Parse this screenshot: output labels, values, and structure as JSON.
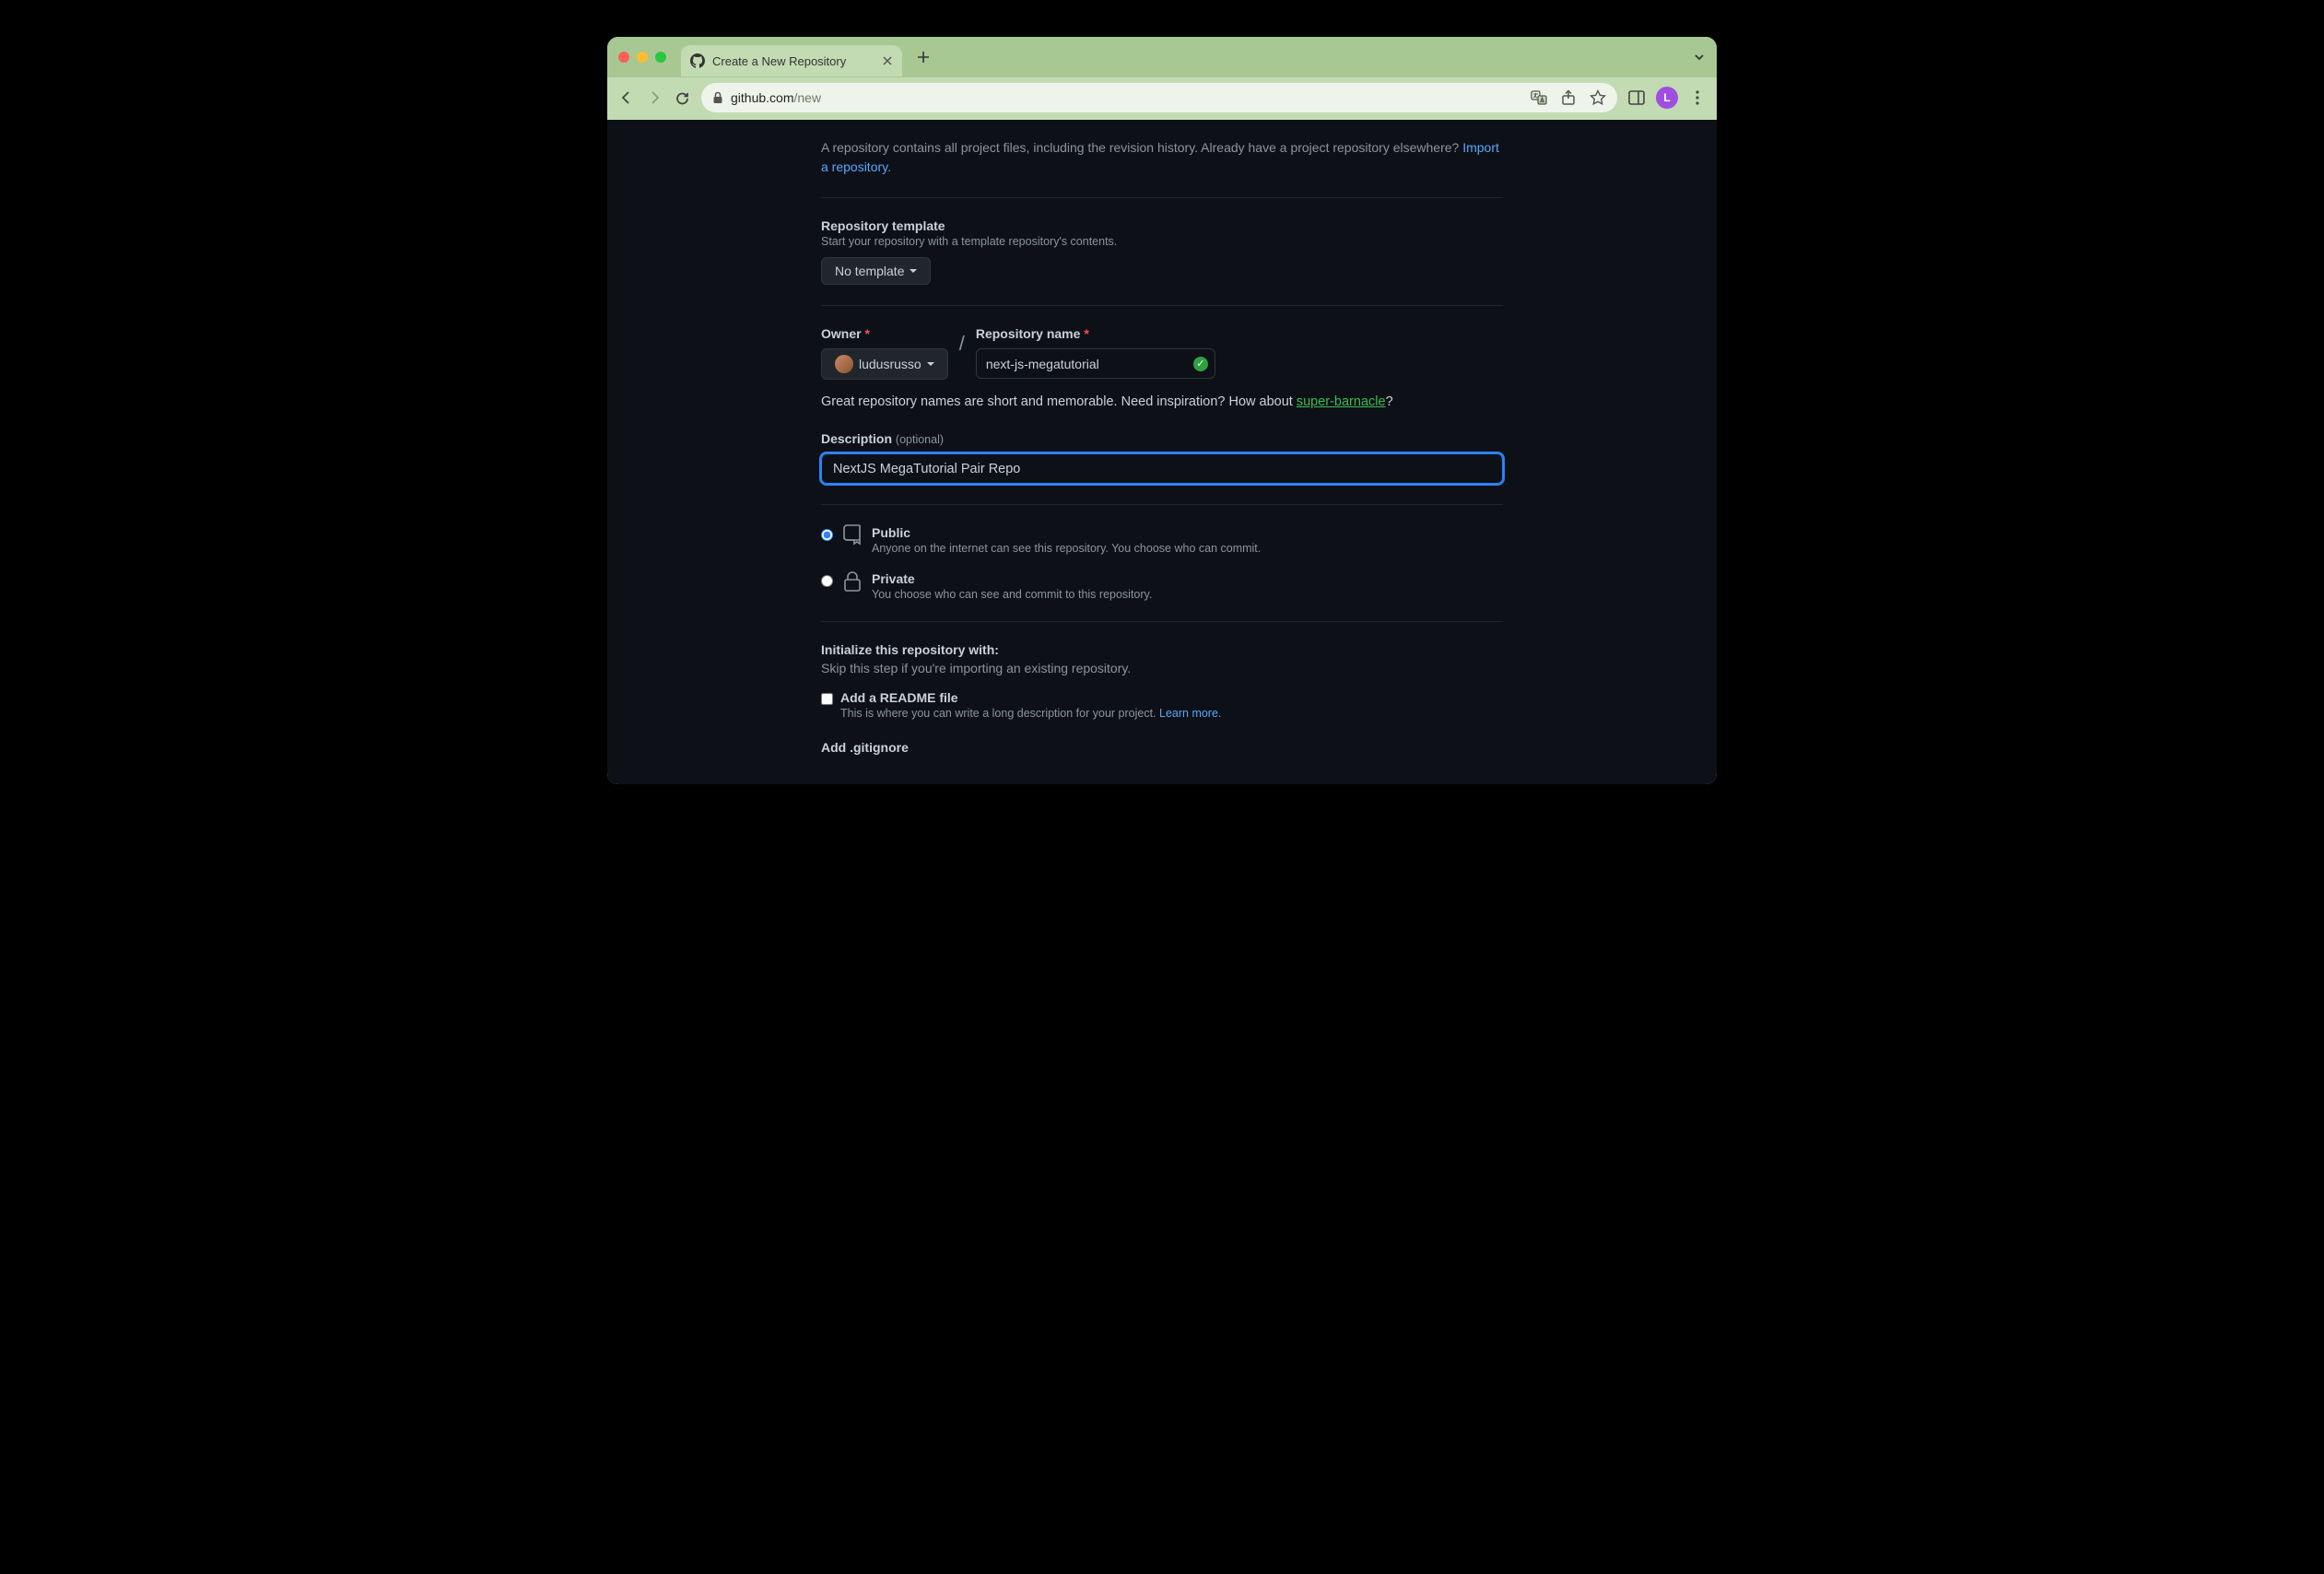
{
  "browser": {
    "tab_title": "Create a New Repository",
    "url_host": "github.com",
    "url_path": "/new",
    "avatar_letter": "L"
  },
  "page": {
    "subtitle_a": "A repository contains all project files, including the revision history. Already have a project repository elsewhere? ",
    "import_link": "Import a repository.",
    "template": {
      "label": "Repository template",
      "sub": "Start your repository with a template repository's contents.",
      "button": "No template"
    },
    "owner": {
      "label": "Owner",
      "value": "ludusrusso"
    },
    "repo": {
      "label": "Repository name",
      "value": "next-js-megatutorial"
    },
    "hint_text": "Great repository names are short and memorable. Need inspiration? How about ",
    "suggest": "super-barnacle",
    "hint_q": "?",
    "description": {
      "label": "Description",
      "optional": "(optional)",
      "value": "NextJS MegaTutorial Pair Repo"
    },
    "visibility": {
      "public": {
        "title": "Public",
        "desc": "Anyone on the internet can see this repository. You choose who can commit."
      },
      "private": {
        "title": "Private",
        "desc": "You choose who can see and commit to this repository."
      }
    },
    "init": {
      "heading": "Initialize this repository with:",
      "sub": "Skip this step if you're importing an existing repository.",
      "readme": {
        "title": "Add a README file",
        "desc": "This is where you can write a long description for your project. ",
        "learn": "Learn more."
      },
      "gitignore_label": "Add .gitignore"
    }
  }
}
